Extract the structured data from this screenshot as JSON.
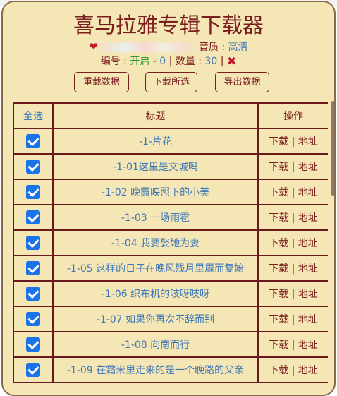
{
  "header": {
    "title": "喜马拉雅专辑下载器",
    "quality_label": "音质 : ",
    "quality_value": "高清",
    "index_label": "编号 : ",
    "index_value": "开启",
    "sep1": " - ",
    "zero": "0",
    "count_label": " | 数量 : ",
    "count_value": "30",
    "sep2": " | "
  },
  "buttons": {
    "reload": "重载数据",
    "download_selected": "下载所选",
    "export": "导出数据"
  },
  "table": {
    "col_select": "全选",
    "col_title": "标题",
    "col_ops": "操作",
    "op_download": "下载",
    "op_sep": " | ",
    "op_address": "地址",
    "rows": [
      {
        "title": "-1-片花"
      },
      {
        "title": "-1-01这里是文城吗"
      },
      {
        "title": "-1-02 晚霞映照下的小美"
      },
      {
        "title": "-1-03 一场雨雹"
      },
      {
        "title": "-1-04 我要娶她为妻"
      },
      {
        "title": "-1-05 这样的日子在晚风残月里周而复始"
      },
      {
        "title": "-1-06 织布机的吱呀吱呀"
      },
      {
        "title": "-1-07 如果你再次不辞而别"
      },
      {
        "title": "-1-08 向南而行"
      },
      {
        "title": "-1-09 在霜米里走来的是一个晚路的父亲"
      }
    ]
  },
  "icons": {
    "heart": "heart-icon",
    "close": "close-icon",
    "checkbox": "checkbox-checked-icon"
  },
  "colors": {
    "panel_bg": "#f5e6b6",
    "accent": "#7a1e1e",
    "link": "#3e78b8",
    "checkbox": "#1a73e8"
  }
}
